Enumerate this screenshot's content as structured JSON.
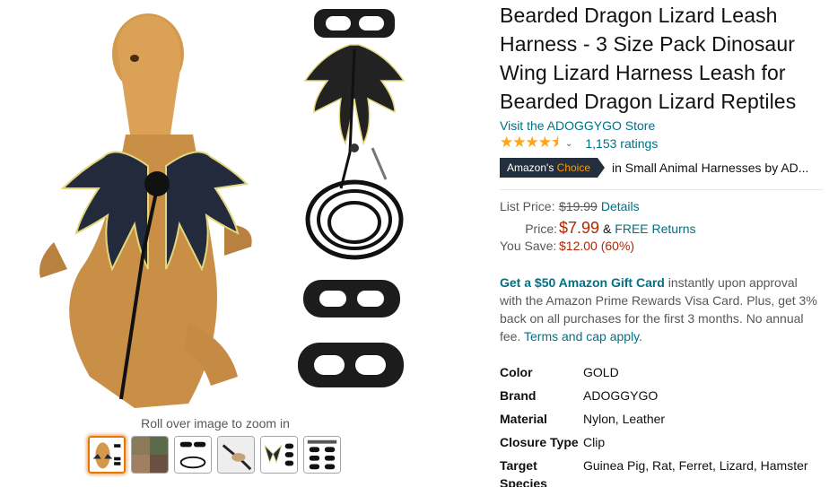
{
  "gallery": {
    "zoom_hint": "Roll over image to zoom in",
    "thumbnails": [
      "thumb-1",
      "thumb-2",
      "thumb-3",
      "thumb-4",
      "thumb-5",
      "thumb-6"
    ],
    "active_thumb": 0
  },
  "product": {
    "title": "Bearded Dragon Lizard Leash Harness - 3 Size Pack Dinosaur Wing Lizard Harness Leash for Bearded Dragon Lizard Reptiles",
    "store_link": "Visit the ADOGGYGO Store",
    "stars": "★★★★⯨",
    "rating_value": 4.5,
    "ratings_count": "1,153 ratings",
    "badge_prefix": "Amazon's ",
    "badge_choice": "Choice",
    "badge_category": "in Small Animal Harnesses by AD..."
  },
  "pricing": {
    "list_label": "List Price:",
    "list_price": "$19.99",
    "details_link": "Details",
    "price_label": "Price:",
    "price": "$7.99",
    "free_returns_prefix": "&",
    "free_returns": "FREE Returns",
    "save_label": "You Save:",
    "save_value": "$12.00 (60%)"
  },
  "promo": {
    "bold": "Get a $50 Amazon Gift Card",
    "text1": " instantly upon approval with the Amazon Prime Rewards Visa Card. Plus, get 3% back on all purchases for the first 3 months. No annual fee. ",
    "link": "Terms and cap apply."
  },
  "specs": [
    {
      "key": "Color",
      "value": "GOLD"
    },
    {
      "key": "Brand",
      "value": "ADOGGYGO"
    },
    {
      "key": "Material",
      "value": "Nylon, Leather"
    },
    {
      "key": "Closure Type",
      "value": "Clip"
    },
    {
      "key": "Target Species",
      "value": "Guinea Pig, Rat, Ferret, Lizard, Hamster"
    }
  ],
  "colors": {
    "link": "#007185",
    "price": "#b12704",
    "star": "#ffa41c",
    "badge_bg": "#232f3e",
    "badge_accent": "#ff9900",
    "thumb_active": "#e77600"
  }
}
